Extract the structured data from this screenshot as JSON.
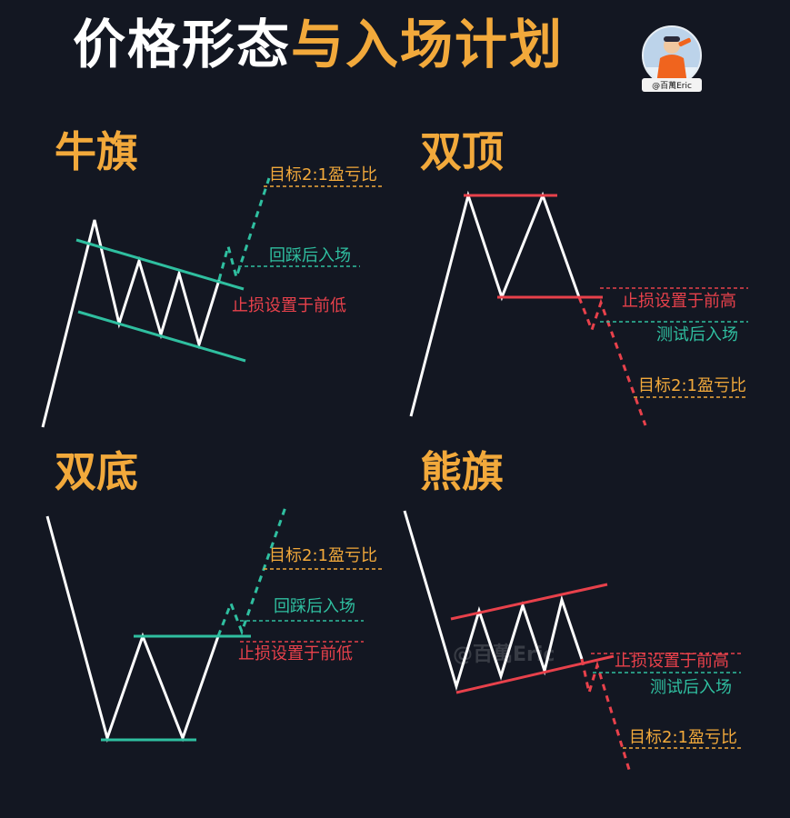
{
  "title": {
    "part1": "价格形态",
    "part2": "与入场计划"
  },
  "author": {
    "handle": "@百萬Eric",
    "watermark": "@百萬Eric"
  },
  "colors": {
    "accent": "#f2a93b",
    "teal": "#2fbfa0",
    "red": "#e8414b",
    "white": "#ffffff",
    "background": "#131722"
  },
  "panels": {
    "bull_flag": {
      "title": "牛旗",
      "target": "目标2:1盈亏比",
      "entry": "回踩后入场",
      "stop": "止损设置于前低"
    },
    "double_top": {
      "title": "双顶",
      "stop": "止损设置于前高",
      "entry": "测试后入场",
      "target": "目标2:1盈亏比"
    },
    "double_bottom": {
      "title": "双底",
      "target": "目标2:1盈亏比",
      "entry": "回踩后入场",
      "stop": "止损设置于前低"
    },
    "bear_flag": {
      "title": "熊旗",
      "stop": "止损设置于前高",
      "entry": "测试后入场",
      "target": "目标2:1盈亏比"
    }
  }
}
